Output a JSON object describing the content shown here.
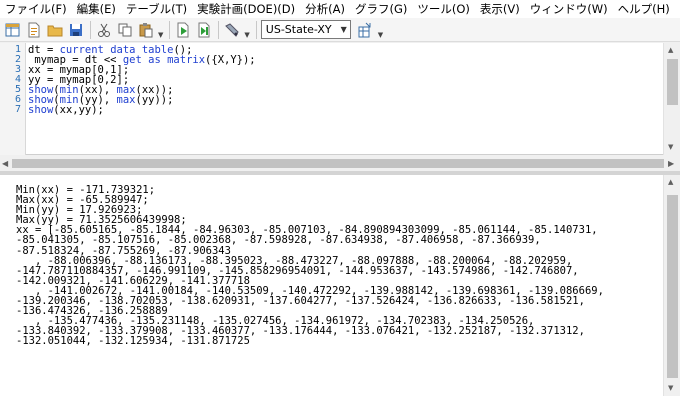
{
  "menu": [
    "ファイル(F)",
    "編集(E)",
    "テーブル(T)",
    "実験計画(DOE)(D)",
    "分析(A)",
    "グラフ(G)",
    "ツール(O)",
    "表示(V)",
    "ウィンドウ(W)",
    "ヘルプ(H)"
  ],
  "toolbar": {
    "icons": [
      "new-data-table-icon",
      "new-script-icon",
      "open-folder-icon",
      "save-icon",
      "cut-icon",
      "copy-icon",
      "paste-icon",
      "run-script-icon",
      "debug-script-icon",
      "tools-icon",
      "table-icon"
    ],
    "combo_value": "US-State-XY"
  },
  "script": {
    "line_numbers": [
      "1",
      "2",
      "3",
      "4",
      "5",
      "6",
      "7"
    ],
    "lines": [
      "dt = current data table();",
      " mymap = dt << get as matrix({X,Y});",
      "xx = mymap[0,1];",
      "yy = mymap[0,2];",
      "show(min(xx), max(xx));",
      "show(min(yy), max(yy));",
      "show(xx,yy);"
    ]
  },
  "log": {
    "lines": [
      "Min(xx) = -171.739321;",
      "Max(xx) = -65.589947;",
      "Min(yy) = 17.926923;",
      "Max(yy) = 71.3525606439998;",
      "xx = [-85.605165, -85.1844, -84.96303, -85.007103, -84.890894303099, -85.061144, -85.140731,",
      "-85.041305, -85.107516, -85.002368, -87.598928, -87.634938, -87.406958, -87.366939,",
      "-87.518324, -87.755269, -87.906343",
      "   , -88.006396, -88.136173, -88.395023, -88.473227, -88.097888, -88.200064, -88.202959,",
      "-147.787110884357, -146.991109, -145.858296954091, -144.953637, -143.574986, -142.746807,",
      "-142.009321, -141.606229, -141.377718",
      "   , -141.002672, -141.00184, -140.53509, -140.472292, -139.988142, -139.698361, -139.086669,",
      "-139.200346, -138.702053, -138.620931, -137.604277, -137.526424, -136.826633, -136.581521,",
      "-136.474326, -136.258889",
      "   , -135.477436, -135.231148, -135.027456, -134.961972, -134.702383, -134.250526,",
      "-133.840392, -133.379908, -133.460377, -133.176444, -133.076421, -132.252187, -132.371312,",
      "-132.051044, -132.125934, -131.871725"
    ]
  }
}
